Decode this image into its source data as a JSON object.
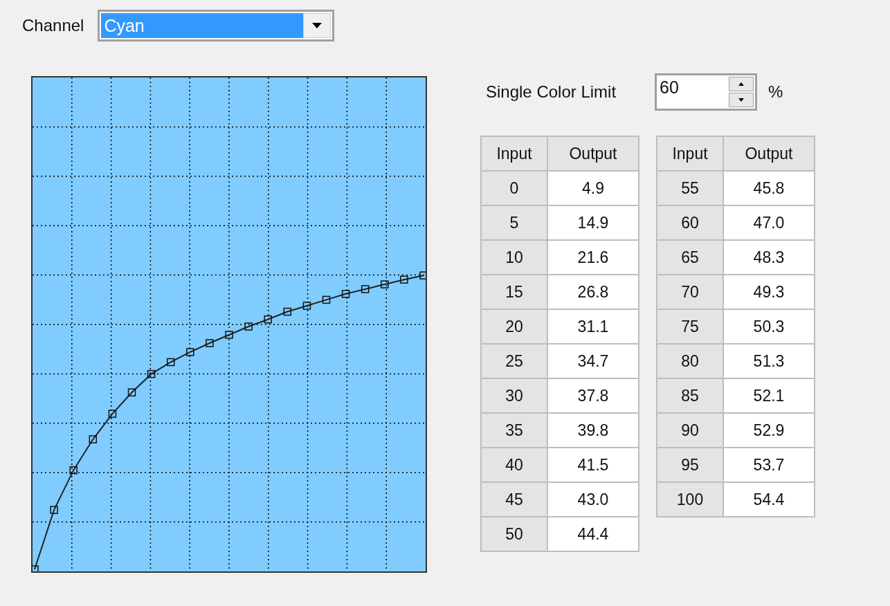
{
  "channel": {
    "label": "Channel",
    "value": "Cyan"
  },
  "single_color_limit": {
    "label": "Single Color Limit",
    "value": "60",
    "unit": "%"
  },
  "tables": [
    {
      "columns": [
        "Input",
        "Output"
      ],
      "rows": [
        [
          "0",
          "4.9"
        ],
        [
          "5",
          "14.9"
        ],
        [
          "10",
          "21.6"
        ],
        [
          "15",
          "26.8"
        ],
        [
          "20",
          "31.1"
        ],
        [
          "25",
          "34.7"
        ],
        [
          "30",
          "37.8"
        ],
        [
          "35",
          "39.8"
        ],
        [
          "40",
          "41.5"
        ],
        [
          "45",
          "43.0"
        ],
        [
          "50",
          "44.4"
        ]
      ]
    },
    {
      "columns": [
        "Input",
        "Output"
      ],
      "rows": [
        [
          "55",
          "45.8"
        ],
        [
          "60",
          "47.0"
        ],
        [
          "65",
          "48.3"
        ],
        [
          "70",
          "49.3"
        ],
        [
          "75",
          "50.3"
        ],
        [
          "80",
          "51.3"
        ],
        [
          "85",
          "52.1"
        ],
        [
          "90",
          "52.9"
        ],
        [
          "95",
          "53.7"
        ],
        [
          "100",
          "54.4"
        ]
      ]
    }
  ]
}
